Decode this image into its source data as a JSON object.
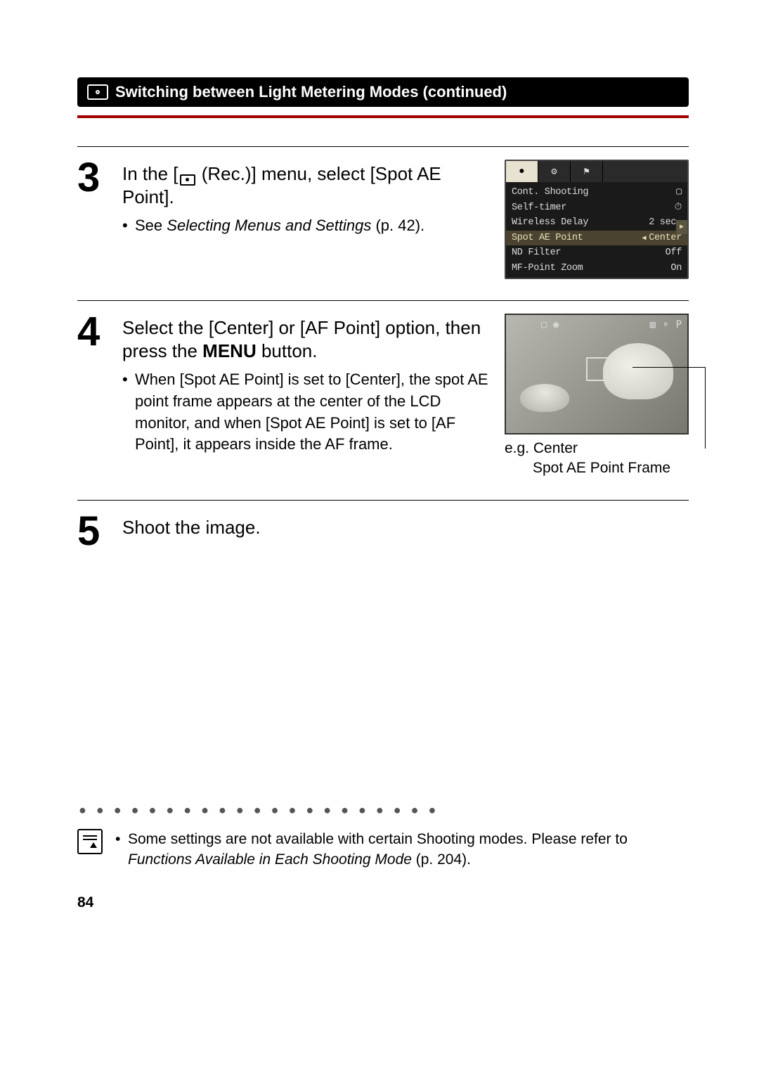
{
  "header": {
    "title": "Switching between Light Metering Modes (continued)"
  },
  "steps": {
    "s3": {
      "number": "3",
      "heading_pre": "In the [",
      "heading_post": " (Rec.)] menu, select [Spot AE Point].",
      "bullet_pre": "See ",
      "bullet_italic": "Selecting Menus and Settings",
      "bullet_post": " (p. 42)."
    },
    "s4": {
      "number": "4",
      "heading_pre": "Select the [Center] or [AF Point] option, then press the ",
      "heading_strong": "MENU",
      "heading_post": " button.",
      "bullet": "When [Spot AE Point] is set to [Center], the spot AE point frame appears at the center of the LCD monitor, and when [Spot AE Point] is set to [AF Point], it appears inside the AF frame.",
      "caption_line1": "e.g. Center",
      "caption_line2": "Spot AE Point Frame"
    },
    "s5": {
      "number": "5",
      "heading": "Shoot the image."
    }
  },
  "menu_screenshot": {
    "tabs": [
      "●",
      "⚙",
      "⚑"
    ],
    "items": [
      {
        "label": "Cont. Shooting",
        "value": "▢"
      },
      {
        "label": "Self-timer",
        "value": "⏱"
      },
      {
        "label": "Wireless Delay",
        "value": "2 sec."
      },
      {
        "label": "Spot AE Point",
        "value": "Center",
        "highlight": true
      },
      {
        "label": "ND Filter",
        "value": "Off"
      },
      {
        "label": "MF-Point Zoom",
        "value": "On"
      }
    ]
  },
  "lcd": {
    "overlay_tl": "▢ ◉",
    "overlay_tr": "▥ ⚬ P"
  },
  "note": {
    "text_pre": "Some settings are not available with certain Shooting modes. Please refer to ",
    "text_italic": "Functions Available in Each Shooting Mode",
    "text_post": " (p. 204)."
  },
  "page_number": "84",
  "dots": "●●●●●●●●●●●●●●●●●●●●●"
}
